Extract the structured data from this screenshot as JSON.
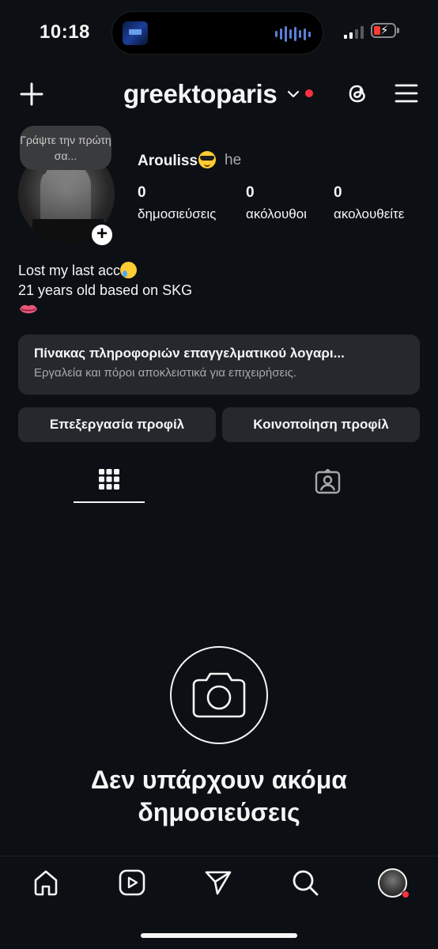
{
  "status_bar": {
    "time": "10:18"
  },
  "header": {
    "username": "greektoparis",
    "icons": [
      "plus-icon",
      "chevron-down-icon",
      "threads-icon",
      "menu-icon"
    ]
  },
  "profile": {
    "note": "Γράψτε την πρώτη σα...",
    "display_name": "Arouliss",
    "pronouns": "he",
    "stats": [
      {
        "value": "0",
        "label": "δημοσιεύσεις"
      },
      {
        "value": "0",
        "label": "ακόλουθοι"
      },
      {
        "value": "0",
        "label": "ακολουθείτε"
      }
    ],
    "bio_line1": "Lost my last acc",
    "bio_line2": "21 years old based on SKG"
  },
  "dashboard": {
    "title": "Πίνακας πληροφοριών επαγγελματικού λογαρι...",
    "subtitle": "Εργαλεία και πόροι αποκλειστικά για επιχειρήσεις."
  },
  "buttons": {
    "edit": "Επεξεργασία προφίλ",
    "share": "Κοινοποίηση προφίλ"
  },
  "tabs": {
    "active": "grid",
    "icons": [
      "grid-icon",
      "tagged-icon"
    ]
  },
  "empty_state": {
    "line1": "Δεν υπάρχουν ακόμα",
    "line2": "δημοσιεύσεις"
  },
  "bottom_nav": {
    "icons": [
      "home-icon",
      "reels-icon",
      "send-icon",
      "search-icon",
      "profile-avatar"
    ]
  },
  "colors": {
    "background": "#0c1014",
    "card": "#25292e",
    "text": "#f5f5f5",
    "secondary_text": "#a8a8a8",
    "notification_red": "#ff3040"
  }
}
